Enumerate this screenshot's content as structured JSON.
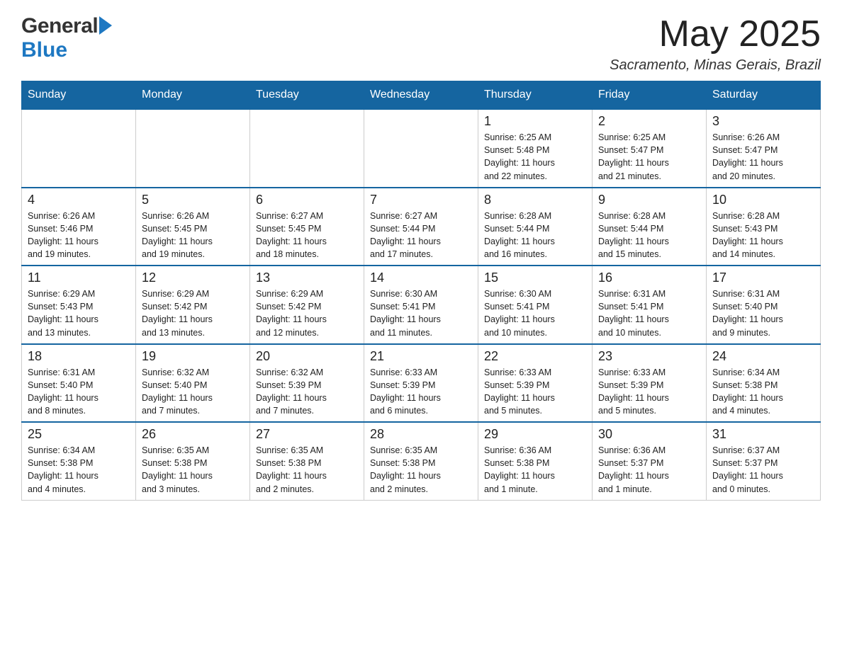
{
  "header": {
    "logo_general": "General",
    "logo_blue": "Blue",
    "month_title": "May 2025",
    "location": "Sacramento, Minas Gerais, Brazil"
  },
  "days_of_week": [
    "Sunday",
    "Monday",
    "Tuesday",
    "Wednesday",
    "Thursday",
    "Friday",
    "Saturday"
  ],
  "weeks": [
    [
      {
        "day": "",
        "info": ""
      },
      {
        "day": "",
        "info": ""
      },
      {
        "day": "",
        "info": ""
      },
      {
        "day": "",
        "info": ""
      },
      {
        "day": "1",
        "info": "Sunrise: 6:25 AM\nSunset: 5:48 PM\nDaylight: 11 hours\nand 22 minutes."
      },
      {
        "day": "2",
        "info": "Sunrise: 6:25 AM\nSunset: 5:47 PM\nDaylight: 11 hours\nand 21 minutes."
      },
      {
        "day": "3",
        "info": "Sunrise: 6:26 AM\nSunset: 5:47 PM\nDaylight: 11 hours\nand 20 minutes."
      }
    ],
    [
      {
        "day": "4",
        "info": "Sunrise: 6:26 AM\nSunset: 5:46 PM\nDaylight: 11 hours\nand 19 minutes."
      },
      {
        "day": "5",
        "info": "Sunrise: 6:26 AM\nSunset: 5:45 PM\nDaylight: 11 hours\nand 19 minutes."
      },
      {
        "day": "6",
        "info": "Sunrise: 6:27 AM\nSunset: 5:45 PM\nDaylight: 11 hours\nand 18 minutes."
      },
      {
        "day": "7",
        "info": "Sunrise: 6:27 AM\nSunset: 5:44 PM\nDaylight: 11 hours\nand 17 minutes."
      },
      {
        "day": "8",
        "info": "Sunrise: 6:28 AM\nSunset: 5:44 PM\nDaylight: 11 hours\nand 16 minutes."
      },
      {
        "day": "9",
        "info": "Sunrise: 6:28 AM\nSunset: 5:44 PM\nDaylight: 11 hours\nand 15 minutes."
      },
      {
        "day": "10",
        "info": "Sunrise: 6:28 AM\nSunset: 5:43 PM\nDaylight: 11 hours\nand 14 minutes."
      }
    ],
    [
      {
        "day": "11",
        "info": "Sunrise: 6:29 AM\nSunset: 5:43 PM\nDaylight: 11 hours\nand 13 minutes."
      },
      {
        "day": "12",
        "info": "Sunrise: 6:29 AM\nSunset: 5:42 PM\nDaylight: 11 hours\nand 13 minutes."
      },
      {
        "day": "13",
        "info": "Sunrise: 6:29 AM\nSunset: 5:42 PM\nDaylight: 11 hours\nand 12 minutes."
      },
      {
        "day": "14",
        "info": "Sunrise: 6:30 AM\nSunset: 5:41 PM\nDaylight: 11 hours\nand 11 minutes."
      },
      {
        "day": "15",
        "info": "Sunrise: 6:30 AM\nSunset: 5:41 PM\nDaylight: 11 hours\nand 10 minutes."
      },
      {
        "day": "16",
        "info": "Sunrise: 6:31 AM\nSunset: 5:41 PM\nDaylight: 11 hours\nand 10 minutes."
      },
      {
        "day": "17",
        "info": "Sunrise: 6:31 AM\nSunset: 5:40 PM\nDaylight: 11 hours\nand 9 minutes."
      }
    ],
    [
      {
        "day": "18",
        "info": "Sunrise: 6:31 AM\nSunset: 5:40 PM\nDaylight: 11 hours\nand 8 minutes."
      },
      {
        "day": "19",
        "info": "Sunrise: 6:32 AM\nSunset: 5:40 PM\nDaylight: 11 hours\nand 7 minutes."
      },
      {
        "day": "20",
        "info": "Sunrise: 6:32 AM\nSunset: 5:39 PM\nDaylight: 11 hours\nand 7 minutes."
      },
      {
        "day": "21",
        "info": "Sunrise: 6:33 AM\nSunset: 5:39 PM\nDaylight: 11 hours\nand 6 minutes."
      },
      {
        "day": "22",
        "info": "Sunrise: 6:33 AM\nSunset: 5:39 PM\nDaylight: 11 hours\nand 5 minutes."
      },
      {
        "day": "23",
        "info": "Sunrise: 6:33 AM\nSunset: 5:39 PM\nDaylight: 11 hours\nand 5 minutes."
      },
      {
        "day": "24",
        "info": "Sunrise: 6:34 AM\nSunset: 5:38 PM\nDaylight: 11 hours\nand 4 minutes."
      }
    ],
    [
      {
        "day": "25",
        "info": "Sunrise: 6:34 AM\nSunset: 5:38 PM\nDaylight: 11 hours\nand 4 minutes."
      },
      {
        "day": "26",
        "info": "Sunrise: 6:35 AM\nSunset: 5:38 PM\nDaylight: 11 hours\nand 3 minutes."
      },
      {
        "day": "27",
        "info": "Sunrise: 6:35 AM\nSunset: 5:38 PM\nDaylight: 11 hours\nand 2 minutes."
      },
      {
        "day": "28",
        "info": "Sunrise: 6:35 AM\nSunset: 5:38 PM\nDaylight: 11 hours\nand 2 minutes."
      },
      {
        "day": "29",
        "info": "Sunrise: 6:36 AM\nSunset: 5:38 PM\nDaylight: 11 hours\nand 1 minute."
      },
      {
        "day": "30",
        "info": "Sunrise: 6:36 AM\nSunset: 5:37 PM\nDaylight: 11 hours\nand 1 minute."
      },
      {
        "day": "31",
        "info": "Sunrise: 6:37 AM\nSunset: 5:37 PM\nDaylight: 11 hours\nand 0 minutes."
      }
    ]
  ]
}
